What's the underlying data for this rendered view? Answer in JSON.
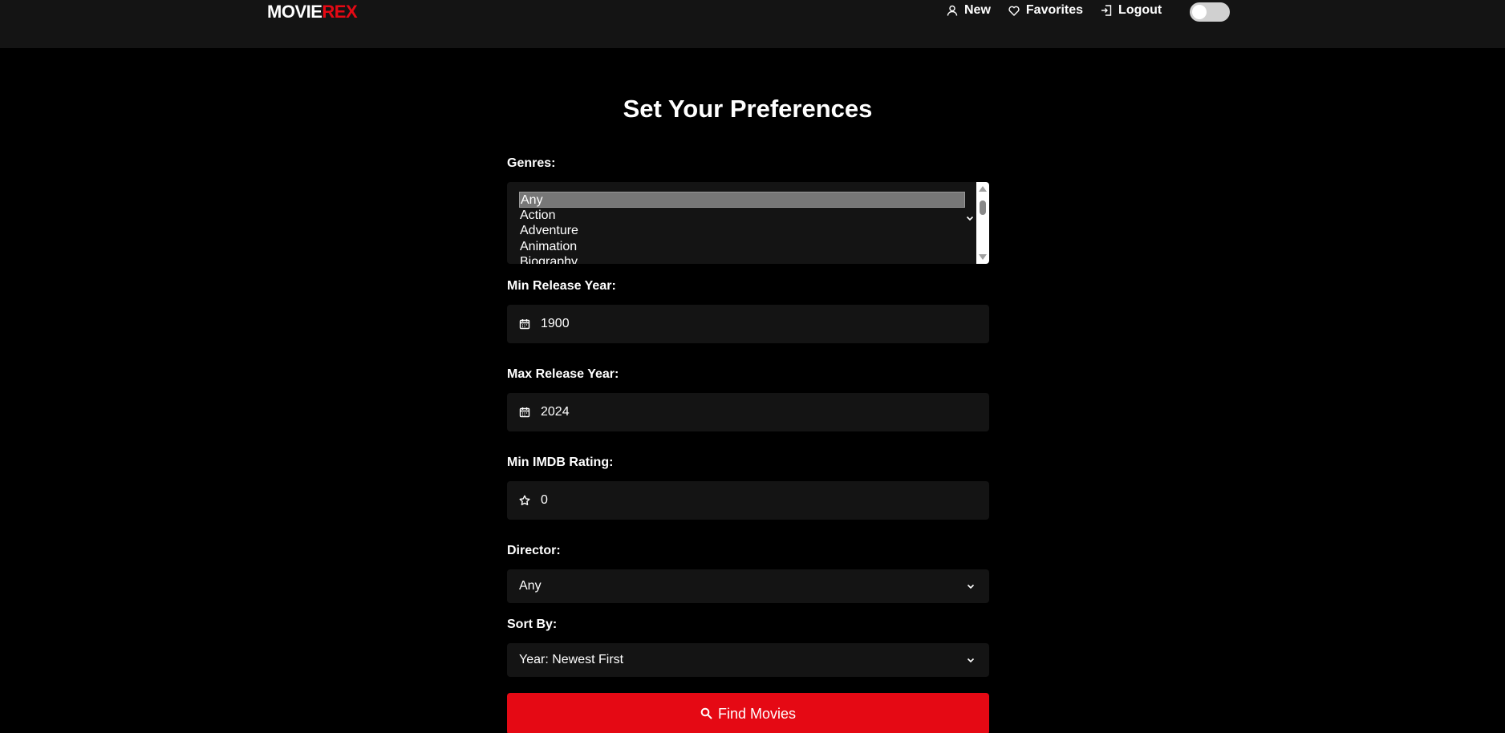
{
  "brand": {
    "part1": "MOVIE",
    "part2": "REX"
  },
  "nav": {
    "new_label": "New",
    "favorites_label": "Favorites",
    "logout_label": "Logout"
  },
  "page": {
    "title": "Set Your Preferences"
  },
  "genres": {
    "label": "Genres:",
    "options": [
      "Any",
      "Action",
      "Adventure",
      "Animation",
      "Biography"
    ],
    "selected": "Any"
  },
  "min_year": {
    "label": "Min Release Year:",
    "value": "1900"
  },
  "max_year": {
    "label": "Max Release Year:",
    "value": "2024"
  },
  "min_rating": {
    "label": "Min IMDB Rating:",
    "value": "0"
  },
  "director": {
    "label": "Director:",
    "value": "Any"
  },
  "sort_by": {
    "label": "Sort By:",
    "value": "Year: Newest First"
  },
  "submit": {
    "label": "Find Movies"
  },
  "icons": {
    "user": "user-icon",
    "heart": "heart-icon",
    "logout": "logout-icon",
    "calendar": "calendar-icon",
    "star": "star-icon",
    "chevron": "chevron-down-icon",
    "search": "search-icon"
  },
  "colors": {
    "accent": "#e50914",
    "background": "#000000",
    "panel": "#141414"
  },
  "theme_toggle": {
    "on": false
  }
}
